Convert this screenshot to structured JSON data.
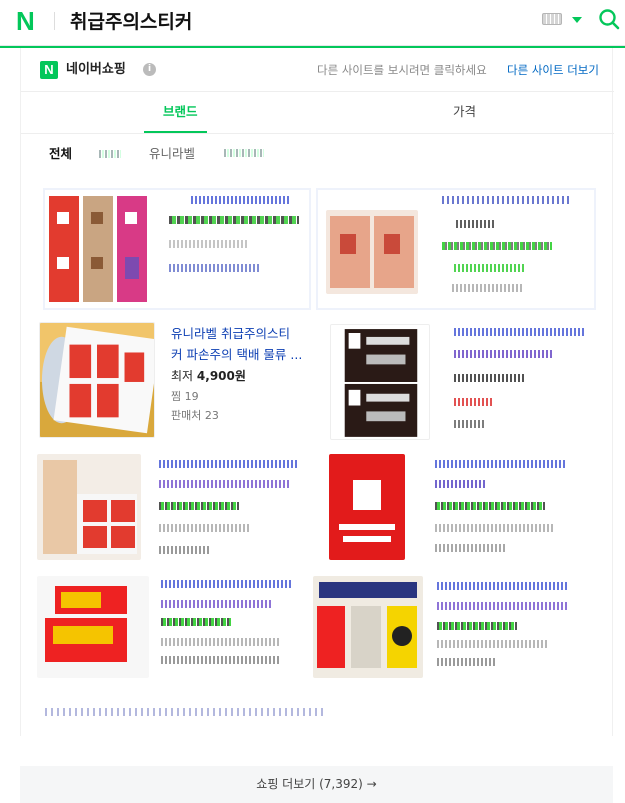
{
  "header": {
    "logo": "N",
    "query": "취급주의스티커",
    "keyboard_icon": "keyboard-icon",
    "dropdown_icon": "triangle-down-icon",
    "search_icon": "search-icon"
  },
  "colors": {
    "accent": "#03c75a",
    "link": "#0068c3",
    "product_title": "#0d3fb3"
  },
  "shopping": {
    "logo_letter": "N",
    "title": "네이버쇼핑",
    "info": "i",
    "other_sites_text": "다른 사이트를 보시려면 클릭하세요",
    "other_sites_link": "다른 사이트 더보기"
  },
  "tabs": [
    {
      "label": "브랜드",
      "active": true
    },
    {
      "label": "가격",
      "active": false
    }
  ],
  "chips": [
    {
      "label": "전체",
      "active": true
    },
    {
      "label": "유니라벨",
      "active": false
    }
  ],
  "featured_product": {
    "title_line1": "유니라벨 취급주의스티",
    "title_line2": "커 파손주의 택배 물류 ...",
    "price_prefix": "최저",
    "price": "4,900원",
    "wishes": "찜 19",
    "sellers": "판매처 23"
  },
  "footer": {
    "more_label": "쇼핑 더보기 (7,392)",
    "arrow": "→"
  }
}
